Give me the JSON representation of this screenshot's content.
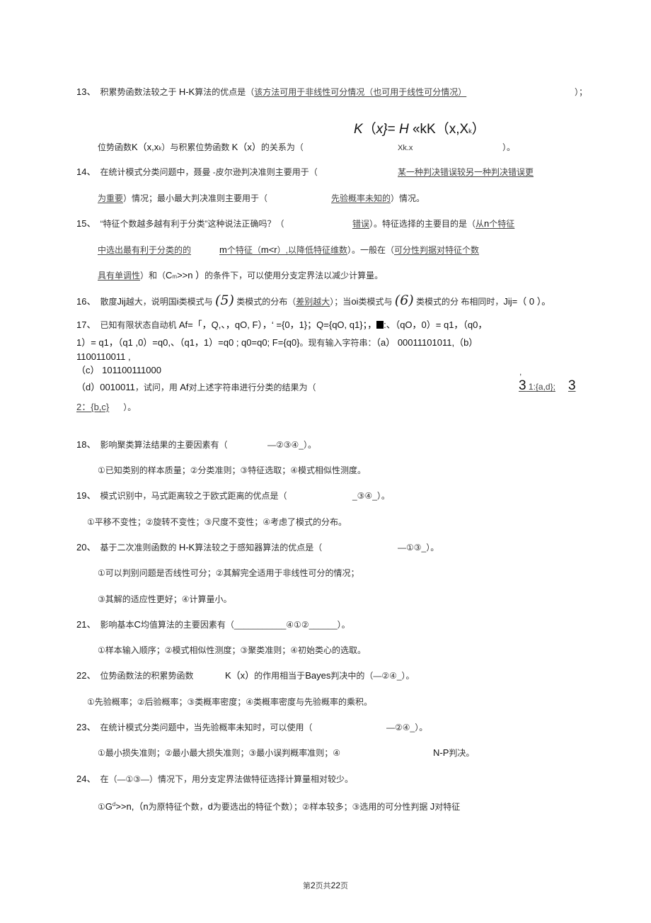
{
  "page": {
    "footer": {
      "prefix": "第",
      "current": "2",
      "mid": "页共",
      "total": "22",
      "suffix": "页"
    }
  },
  "questions": {
    "q13": {
      "num": "13、",
      "line1_a": "积累势函数法较之于 ",
      "line1_b": "H-K",
      "line1_c": "算法的优点是（",
      "line1_answer": "该方法可用于非线性可分情况（也可用于线性可分情况）",
      "line1_end": "）；",
      "formula": {
        "K": "K",
        "lp": "（",
        "x": "x}",
        "eq": "= ",
        "H": "H",
        "rest": " «kK（x,X",
        "sub": "k",
        "rp": "）"
      },
      "line2_a": "位势函数",
      "line2_b": "K（x,x",
      "line2_c": "）与积累位势函数 ",
      "line2_d": "K（x）",
      "line2_e": "的关系为（",
      "line2_answer": "Xk.x",
      "line2_end": "）。"
    },
    "q14": {
      "num": "14、",
      "line1_a": "在统计模式分类问题中，聂曼 -皮尔逊判决准则主要用于（",
      "line1_answer": "某一种判决错误较另一种判决错误更",
      "line2_answer": "为重要",
      "line2_a": "）情况；最小最大判决准则主要用于（",
      "line2_answer2": "先验概率未知的",
      "line2_end": "）情况。"
    },
    "q15": {
      "num": "15、",
      "line1_a": "“特征个数越多越有利于分类”这种说法正确吗？（",
      "line1_answer": "错误",
      "line1_b": "）。特征选择的主要目的是（",
      "line1_answer2a": "从",
      "line1_answer2b": "n",
      "line1_answer2c": "个特征",
      "line2_answer_a": "中选出最有利于分类的的",
      "line2_answer_b": "m",
      "line2_answer_c": "个特征（",
      "line2_answer_d": "m<r",
      "line2_answer_e": "）,以降低特征维数",
      "line2_b": "）。一般在（",
      "line2_answer2": "可分性判据对特征个数",
      "line3_answer": "具有单调性",
      "line3_a": "）和（",
      "line3_b": "C",
      "line3_sub": "m",
      "line3_c": ">>n ）",
      "line3_d": "的条件下，可以使用分支定界法以减少计算量。"
    },
    "q16": {
      "num": "16、",
      "a": "散度",
      "b": "Jij",
      "c": "越大，说明国",
      "d": "i",
      "e": "类模式与 ",
      "mark5": "(5)",
      "f": " 类模式的分布（",
      "answer": "差别越大",
      "g": "）；当",
      "h": "oi",
      "i": "类模式与 ",
      "mark6": "(6)",
      "j": " 类模式的分 布相同时，",
      "k": "Jij=（ 0 ）。"
    },
    "q17": {
      "num": "17、",
      "line1_a": "已知有限状态自动机 ",
      "line1_b": "Af=「，Q,、，qO, F），‘ ={0，1}；Q={qO, q1}；，",
      "line1_c": ":、（qO，0）= q1，（q0，",
      "line2_a": "1）= q1，（q1 ,0）=q0,、（q1，1）=q0 ; q0=q0; F={q0}",
      "line2_b": "。现有输入字符串：",
      "line2_c": "（a） 00011101011,（b）",
      "line3": "1100110011 ,",
      "line4": "（c） 101100111000",
      "line4_comma": ",",
      "line5_a": "（d）0010011",
      "line5_b": "，试问，用 ",
      "line5_c": "Af",
      "line5_d": "对上述字符串进行分类的结果为（",
      "line5_answer_a": "3",
      "line5_answer_b": " 1:{a,d};",
      "line5_answer_c": "3",
      "line6_answer": "2：{b,c}",
      "line6_end": "）。"
    },
    "q18": {
      "num": "18、",
      "a": "影响聚类算法结果的主要因素有（",
      "answer": "—②③④_",
      "end": "）。",
      "options": "①已知类别的样本质量；②分类准则；③特征选取；④模式相似性测度。"
    },
    "q19": {
      "num": "19、",
      "a": "模式识别中，马式距离较之于欧式距离的优点是（",
      "answer": "_③④_",
      "end": "）。",
      "options": "①平移不变性；②旋转不变性；③尺度不变性；④考虑了模式的分布。"
    },
    "q20": {
      "num": "20、",
      "a": "基于二次准则函数的 ",
      "b": "H-K",
      "c": "算法较之于感知器算法的优点是（",
      "answer": "—①③_",
      "end": "）。",
      "options1": "①可以判别问题是否线性可分；②其解完全适用于非线性可分的情况；",
      "options2": "③其解的适应性更好；④计算量小。"
    },
    "q21": {
      "num": "21、",
      "a": "影响基本",
      "b": "C",
      "c": "均值算法的主要因素有（",
      "answer": "___________④①②______",
      "end": "）。",
      "options": "①样本输入顺序；②模式相似性测度；③聚类准则；④初始类心的选取。"
    },
    "q22": {
      "num": "22、",
      "a": "位势函数法的积累势函数",
      "b": "K（x）",
      "c": "的作用相当于",
      "d": "Bayes",
      "e": "判决中的（",
      "answer": "—②④_",
      "end": "）。",
      "options": "①先验概率；②后验概率；③类概率密度；④类概率密度与先验概率的乘积。"
    },
    "q23": {
      "num": "23、",
      "a": "在统计模式分类问题中，当先验概率未知时，可以使用（",
      "answer": "—②④_",
      "end": "）。",
      "options_a": "①最小损失准则；②最小最大损失准则；③最小误判概率准则；④",
      "options_b": "N-P",
      "options_c": "判决。"
    },
    "q24": {
      "num": "24、",
      "a": "在（",
      "answer": "—①③—",
      "b": "）情况下，用分支定界法做特征选择计算量相对较少。",
      "opt_a": "①",
      "opt_b": "G",
      "opt_sup": "d",
      "opt_c": ">>n,（",
      "opt_d": "n",
      "opt_e": "为原特征个数，",
      "opt_f": "d",
      "opt_g": "为要选出的特征个数）；②样本较多；③选用的可分性判据 ",
      "opt_h": "J",
      "opt_i": "对特征"
    }
  }
}
